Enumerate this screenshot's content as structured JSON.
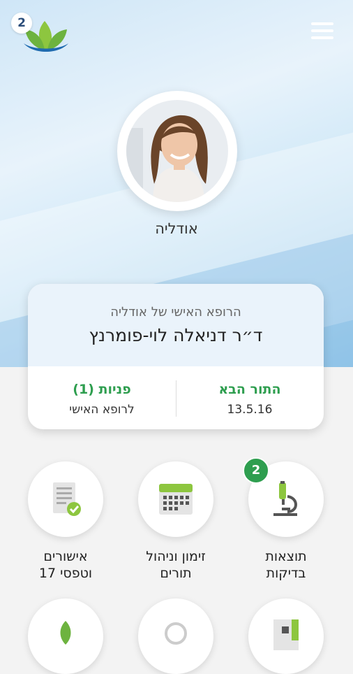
{
  "header": {
    "logo_badge": "2",
    "menu_icon": "hamburger-menu-icon"
  },
  "profile": {
    "name": "אודליה"
  },
  "doctor_card": {
    "subtitle": "הרופא האישי של אודליה",
    "doctor_name": "ד״ר דניאלה לוי-פומרנץ",
    "next_appointment_title": "התור הבא",
    "next_appointment_date": "13.5.16",
    "inquiries_title": "פניות (1)",
    "inquiries_sub": "לרופא האישי"
  },
  "tiles": [
    {
      "label_1": "תוצאות",
      "label_2": "בדיקות",
      "icon": "microscope-icon",
      "badge": "2"
    },
    {
      "label_1": "זימון וניהול",
      "label_2": "תורים",
      "icon": "calendar-icon"
    },
    {
      "label_1": "אישורים",
      "label_2": "וטפסי 17",
      "icon": "document-approved-icon"
    }
  ],
  "colors": {
    "accent_green": "#2e9e4f",
    "hero_blue": "#9ccbea"
  }
}
